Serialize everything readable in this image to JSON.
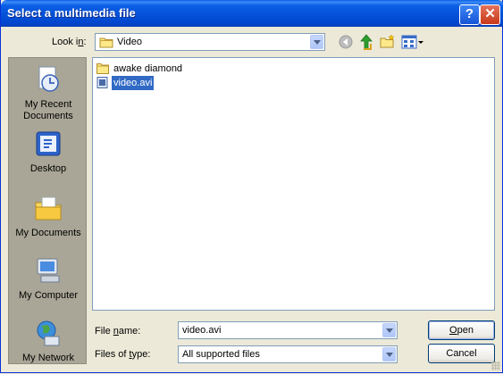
{
  "window": {
    "title": "Select a multimedia file",
    "help_glyph": "?",
    "close_glyph": "✕"
  },
  "lookin": {
    "label": "Look in:",
    "value": "Video"
  },
  "toolbar": {
    "icons": [
      "back-icon",
      "up-folder-icon",
      "new-folder-icon",
      "views-menu-icon"
    ]
  },
  "places": [
    {
      "label": "My Recent Documents",
      "icon": "recent-documents-icon"
    },
    {
      "label": "Desktop",
      "icon": "desktop-icon"
    },
    {
      "label": "My Documents",
      "icon": "my-documents-icon"
    },
    {
      "label": "My Computer",
      "icon": "my-computer-icon"
    },
    {
      "label": "My Network",
      "icon": "my-network-icon"
    }
  ],
  "files": [
    {
      "name": "awake diamond",
      "type": "folder"
    },
    {
      "name": "video.avi",
      "type": "file",
      "selected": true
    }
  ],
  "filename": {
    "label": "File name:",
    "value": "video.avi"
  },
  "filetype": {
    "label": "Files of type:",
    "value": "All supported files"
  },
  "buttons": {
    "open": "Open",
    "cancel": "Cancel"
  },
  "colors": {
    "title_bar": "#0a5fe8",
    "selection": "#316ac5",
    "dialog_bg": "#ece9d8"
  }
}
